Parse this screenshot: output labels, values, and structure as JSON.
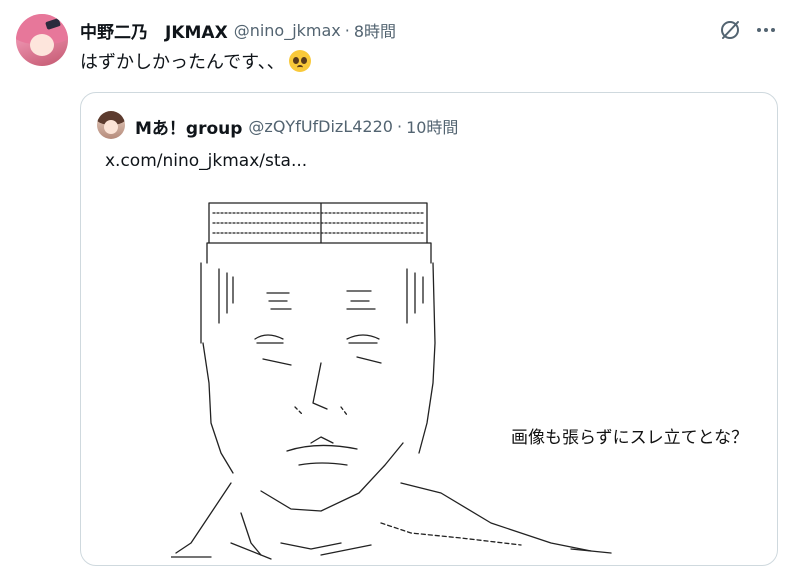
{
  "tweet": {
    "display_name": "中野二乃　JKMAX",
    "handle": "@nino_jkmax",
    "separator": "·",
    "time": "8時間",
    "text": "はずかしかったんです、、",
    "emoji": "pleading-face"
  },
  "quote": {
    "display_name": "Mあ！group",
    "handle": "@zQYfUfDizL4220",
    "separator": "·",
    "time": "10時間",
    "text": "x.com/nino_jkmax/sta...",
    "image": {
      "caption": "画像も張らずにスレ立てとな？"
    }
  },
  "icons": {
    "grok": "grok-icon",
    "more": "more-icon"
  }
}
